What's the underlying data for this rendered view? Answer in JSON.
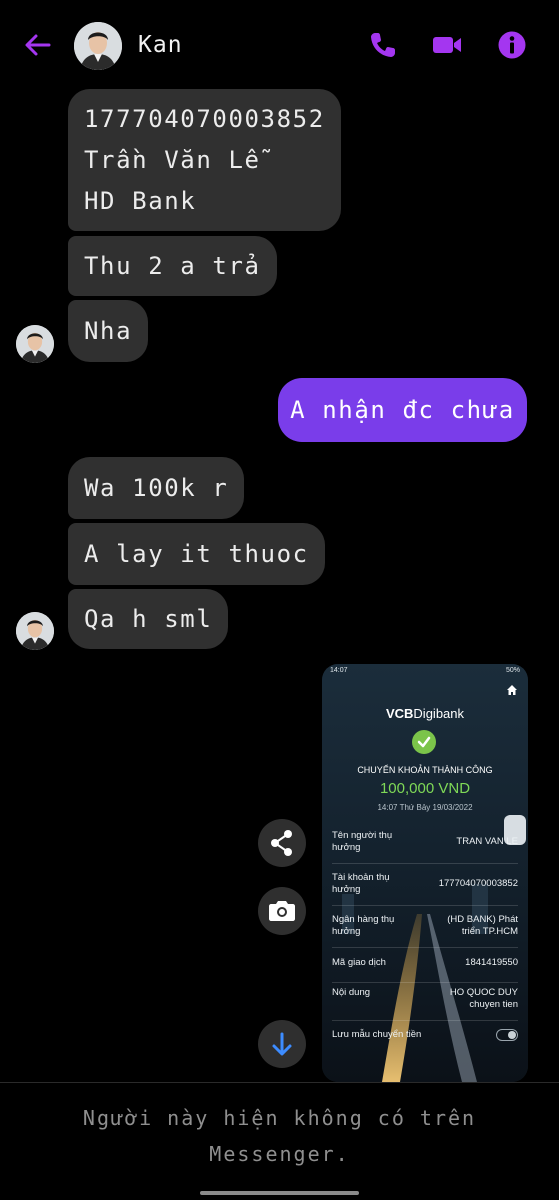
{
  "header": {
    "contact_name": "Kan",
    "back_icon": "arrow-left-icon",
    "call_icon": "phone-icon",
    "video_icon": "video-camera-icon",
    "info_icon": "info-icon",
    "accent": "#a436f0"
  },
  "messages": [
    {
      "lines": [
        "177704070003852",
        "Trần Văn Lễ",
        "HD Bank"
      ],
      "direction": "incoming"
    },
    {
      "text": "Thu 2 a trả",
      "direction": "incoming"
    },
    {
      "text": "Nha",
      "direction": "incoming"
    },
    {
      "text": "A nhận đc chưa",
      "direction": "outgoing"
    },
    {
      "text": "Wa 100k r",
      "direction": "incoming"
    },
    {
      "text": "A lay it thuoc",
      "direction": "incoming"
    },
    {
      "text": "Qa h sml",
      "direction": "incoming"
    }
  ],
  "shared_image": {
    "status_time": "14:07",
    "battery": "50%",
    "logo_bold": "VCB",
    "logo_rest": "Digibank",
    "success_text": "CHUYỂN KHOẢN THÀNH CÔNG",
    "amount": "100,000 VND",
    "datetime": "14:07 Thứ Bảy 19/03/2022",
    "rows": [
      {
        "label": "Tên người thụ hưởng",
        "value": "TRAN VAN LE"
      },
      {
        "label": "Tài khoản thụ hưởng",
        "value": "177704070003852"
      },
      {
        "label": "Ngân hàng thụ hưởng",
        "value": "(HD BANK) Phát triển TP.HCM"
      },
      {
        "label": "Mã giao dịch",
        "value": "1841419550"
      },
      {
        "label": "Nội dung",
        "value": "HO QUOC DUY chuyen tien"
      },
      {
        "label": "Lưu mẫu chuyển tiền",
        "value": ""
      }
    ]
  },
  "actions": {
    "share_icon": "share-icon",
    "camera_icon": "camera-icon",
    "scroll_down_icon": "arrow-down-icon"
  },
  "footer": {
    "notice_line1": "Người này hiện không có trên",
    "notice_line2": "Messenger."
  }
}
